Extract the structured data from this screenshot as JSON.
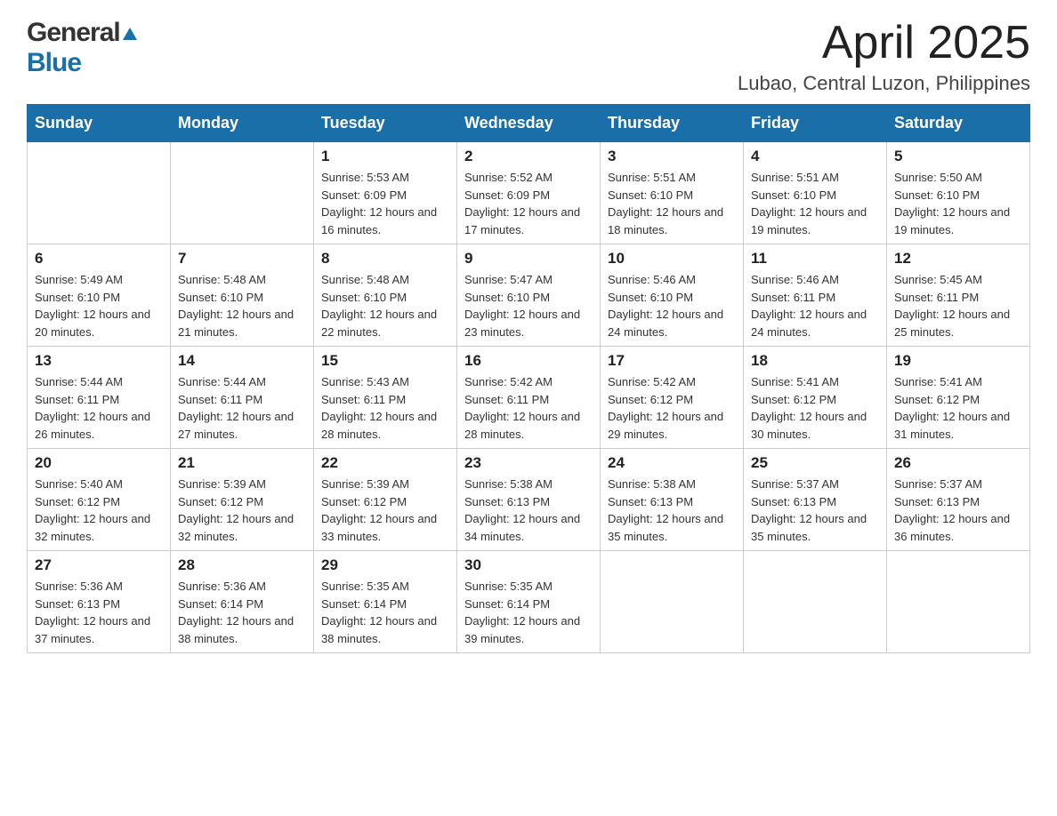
{
  "logo": {
    "general": "General",
    "blue": "Blue"
  },
  "header": {
    "month": "April 2025",
    "location": "Lubao, Central Luzon, Philippines"
  },
  "weekdays": [
    "Sunday",
    "Monday",
    "Tuesday",
    "Wednesday",
    "Thursday",
    "Friday",
    "Saturday"
  ],
  "weeks": [
    [
      {
        "day": "",
        "info": ""
      },
      {
        "day": "",
        "info": ""
      },
      {
        "day": "1",
        "info": "Sunrise: 5:53 AM\nSunset: 6:09 PM\nDaylight: 12 hours\nand 16 minutes."
      },
      {
        "day": "2",
        "info": "Sunrise: 5:52 AM\nSunset: 6:09 PM\nDaylight: 12 hours\nand 17 minutes."
      },
      {
        "day": "3",
        "info": "Sunrise: 5:51 AM\nSunset: 6:10 PM\nDaylight: 12 hours\nand 18 minutes."
      },
      {
        "day": "4",
        "info": "Sunrise: 5:51 AM\nSunset: 6:10 PM\nDaylight: 12 hours\nand 19 minutes."
      },
      {
        "day": "5",
        "info": "Sunrise: 5:50 AM\nSunset: 6:10 PM\nDaylight: 12 hours\nand 19 minutes."
      }
    ],
    [
      {
        "day": "6",
        "info": "Sunrise: 5:49 AM\nSunset: 6:10 PM\nDaylight: 12 hours\nand 20 minutes."
      },
      {
        "day": "7",
        "info": "Sunrise: 5:48 AM\nSunset: 6:10 PM\nDaylight: 12 hours\nand 21 minutes."
      },
      {
        "day": "8",
        "info": "Sunrise: 5:48 AM\nSunset: 6:10 PM\nDaylight: 12 hours\nand 22 minutes."
      },
      {
        "day": "9",
        "info": "Sunrise: 5:47 AM\nSunset: 6:10 PM\nDaylight: 12 hours\nand 23 minutes."
      },
      {
        "day": "10",
        "info": "Sunrise: 5:46 AM\nSunset: 6:10 PM\nDaylight: 12 hours\nand 24 minutes."
      },
      {
        "day": "11",
        "info": "Sunrise: 5:46 AM\nSunset: 6:11 PM\nDaylight: 12 hours\nand 24 minutes."
      },
      {
        "day": "12",
        "info": "Sunrise: 5:45 AM\nSunset: 6:11 PM\nDaylight: 12 hours\nand 25 minutes."
      }
    ],
    [
      {
        "day": "13",
        "info": "Sunrise: 5:44 AM\nSunset: 6:11 PM\nDaylight: 12 hours\nand 26 minutes."
      },
      {
        "day": "14",
        "info": "Sunrise: 5:44 AM\nSunset: 6:11 PM\nDaylight: 12 hours\nand 27 minutes."
      },
      {
        "day": "15",
        "info": "Sunrise: 5:43 AM\nSunset: 6:11 PM\nDaylight: 12 hours\nand 28 minutes."
      },
      {
        "day": "16",
        "info": "Sunrise: 5:42 AM\nSunset: 6:11 PM\nDaylight: 12 hours\nand 28 minutes."
      },
      {
        "day": "17",
        "info": "Sunrise: 5:42 AM\nSunset: 6:12 PM\nDaylight: 12 hours\nand 29 minutes."
      },
      {
        "day": "18",
        "info": "Sunrise: 5:41 AM\nSunset: 6:12 PM\nDaylight: 12 hours\nand 30 minutes."
      },
      {
        "day": "19",
        "info": "Sunrise: 5:41 AM\nSunset: 6:12 PM\nDaylight: 12 hours\nand 31 minutes."
      }
    ],
    [
      {
        "day": "20",
        "info": "Sunrise: 5:40 AM\nSunset: 6:12 PM\nDaylight: 12 hours\nand 32 minutes."
      },
      {
        "day": "21",
        "info": "Sunrise: 5:39 AM\nSunset: 6:12 PM\nDaylight: 12 hours\nand 32 minutes."
      },
      {
        "day": "22",
        "info": "Sunrise: 5:39 AM\nSunset: 6:12 PM\nDaylight: 12 hours\nand 33 minutes."
      },
      {
        "day": "23",
        "info": "Sunrise: 5:38 AM\nSunset: 6:13 PM\nDaylight: 12 hours\nand 34 minutes."
      },
      {
        "day": "24",
        "info": "Sunrise: 5:38 AM\nSunset: 6:13 PM\nDaylight: 12 hours\nand 35 minutes."
      },
      {
        "day": "25",
        "info": "Sunrise: 5:37 AM\nSunset: 6:13 PM\nDaylight: 12 hours\nand 35 minutes."
      },
      {
        "day": "26",
        "info": "Sunrise: 5:37 AM\nSunset: 6:13 PM\nDaylight: 12 hours\nand 36 minutes."
      }
    ],
    [
      {
        "day": "27",
        "info": "Sunrise: 5:36 AM\nSunset: 6:13 PM\nDaylight: 12 hours\nand 37 minutes."
      },
      {
        "day": "28",
        "info": "Sunrise: 5:36 AM\nSunset: 6:14 PM\nDaylight: 12 hours\nand 38 minutes."
      },
      {
        "day": "29",
        "info": "Sunrise: 5:35 AM\nSunset: 6:14 PM\nDaylight: 12 hours\nand 38 minutes."
      },
      {
        "day": "30",
        "info": "Sunrise: 5:35 AM\nSunset: 6:14 PM\nDaylight: 12 hours\nand 39 minutes."
      },
      {
        "day": "",
        "info": ""
      },
      {
        "day": "",
        "info": ""
      },
      {
        "day": "",
        "info": ""
      }
    ]
  ]
}
